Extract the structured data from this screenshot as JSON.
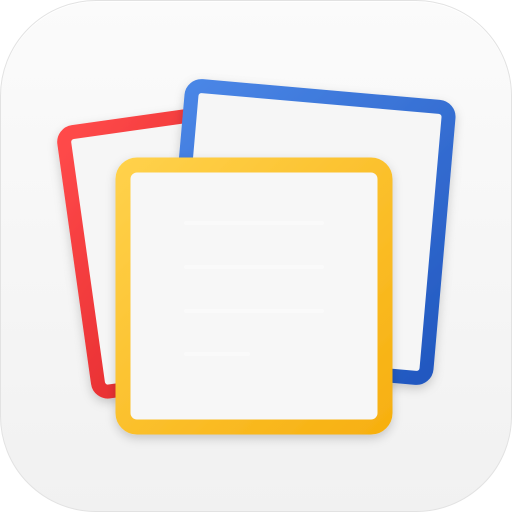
{
  "app_icon": {
    "icon": "notebook-cards-icon",
    "colors": {
      "background": "#f4f4f4",
      "card_red": "#e8262b",
      "card_blue": "#2f6fd2",
      "card_yellow": "#fdbf1e",
      "text_lines": "#3a78d8",
      "card_fill": "#f7f7f7"
    }
  }
}
